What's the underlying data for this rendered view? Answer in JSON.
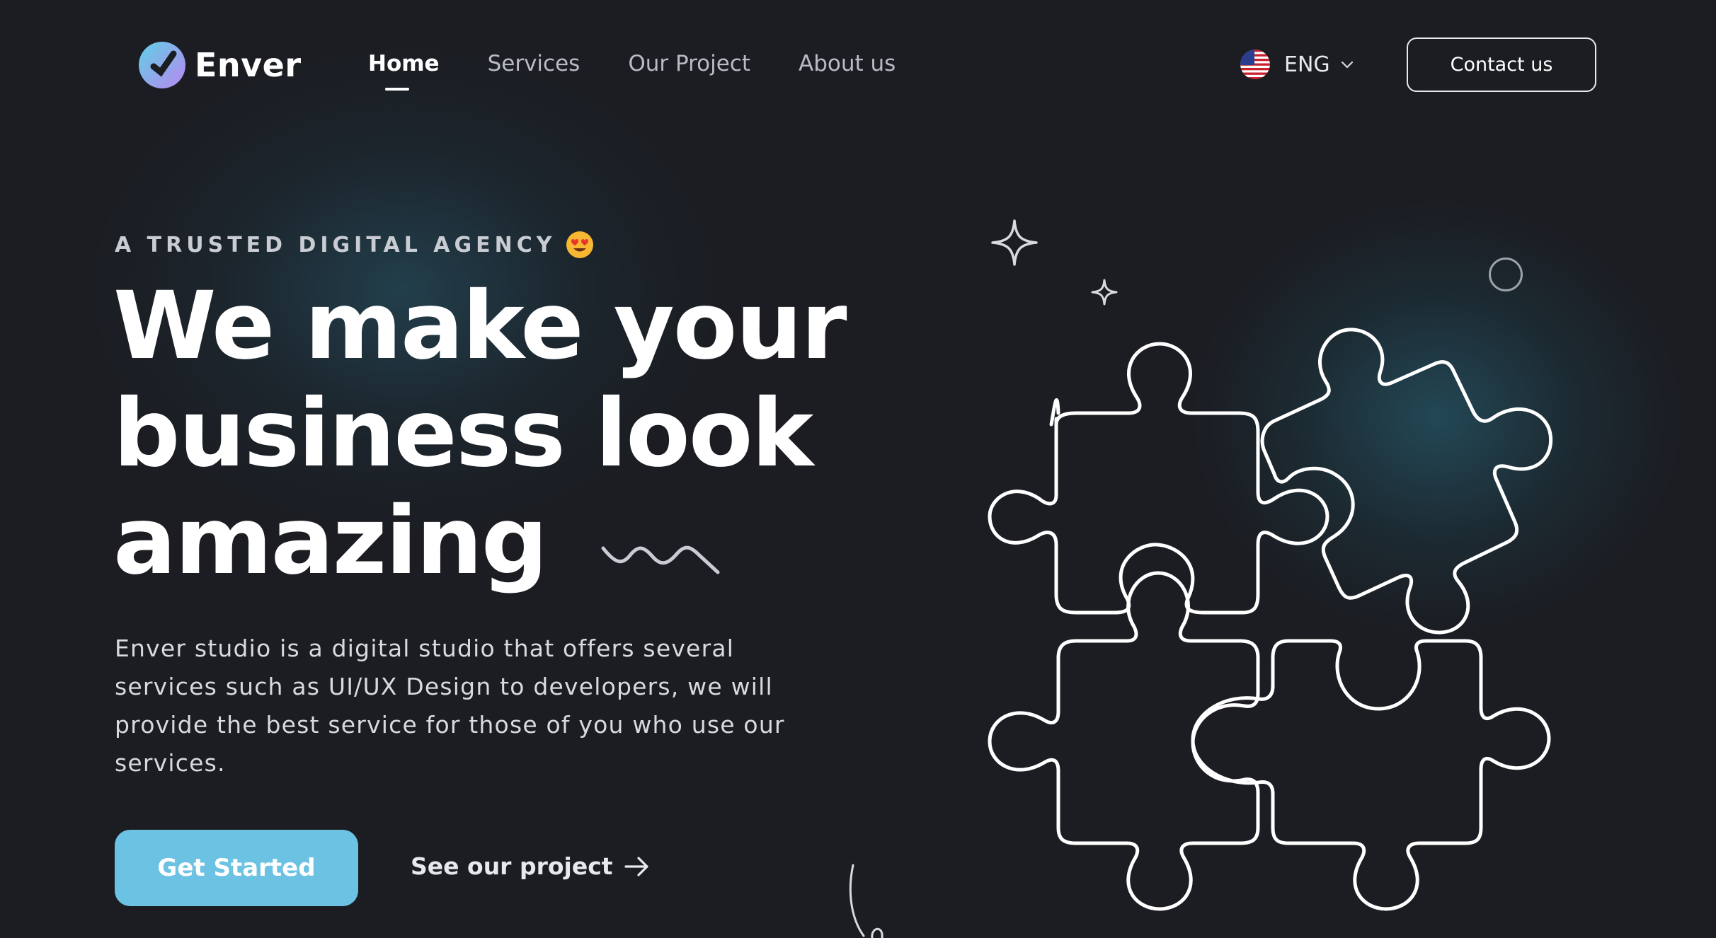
{
  "brand": {
    "name": "Enver",
    "logo_icon": "enver-logo-icon"
  },
  "nav": {
    "links": [
      "Home",
      "Services",
      "Our Project",
      "About us"
    ],
    "active": "Home",
    "language": {
      "label": "ENG",
      "flag_icon": "us-flag-icon"
    },
    "contact_label": "Contact us"
  },
  "hero": {
    "eyebrow": "A TRUSTED DIGITAL AGENCY",
    "eyebrow_emoji": "heart-eyes-emoji",
    "headline": [
      "We make your",
      "business look",
      "amazing"
    ],
    "description": "Enver studio is a digital studio that offers several services such as UI/UX Design to developers, we will provide the best service for those of you who use our services.",
    "primary_cta": "Get Started",
    "secondary_cta": "See our project"
  },
  "colors": {
    "background": "#1b1d22",
    "accent": "#6cc2e2",
    "logo_gradient": [
      "#5fd0e6",
      "#b987f0"
    ]
  }
}
